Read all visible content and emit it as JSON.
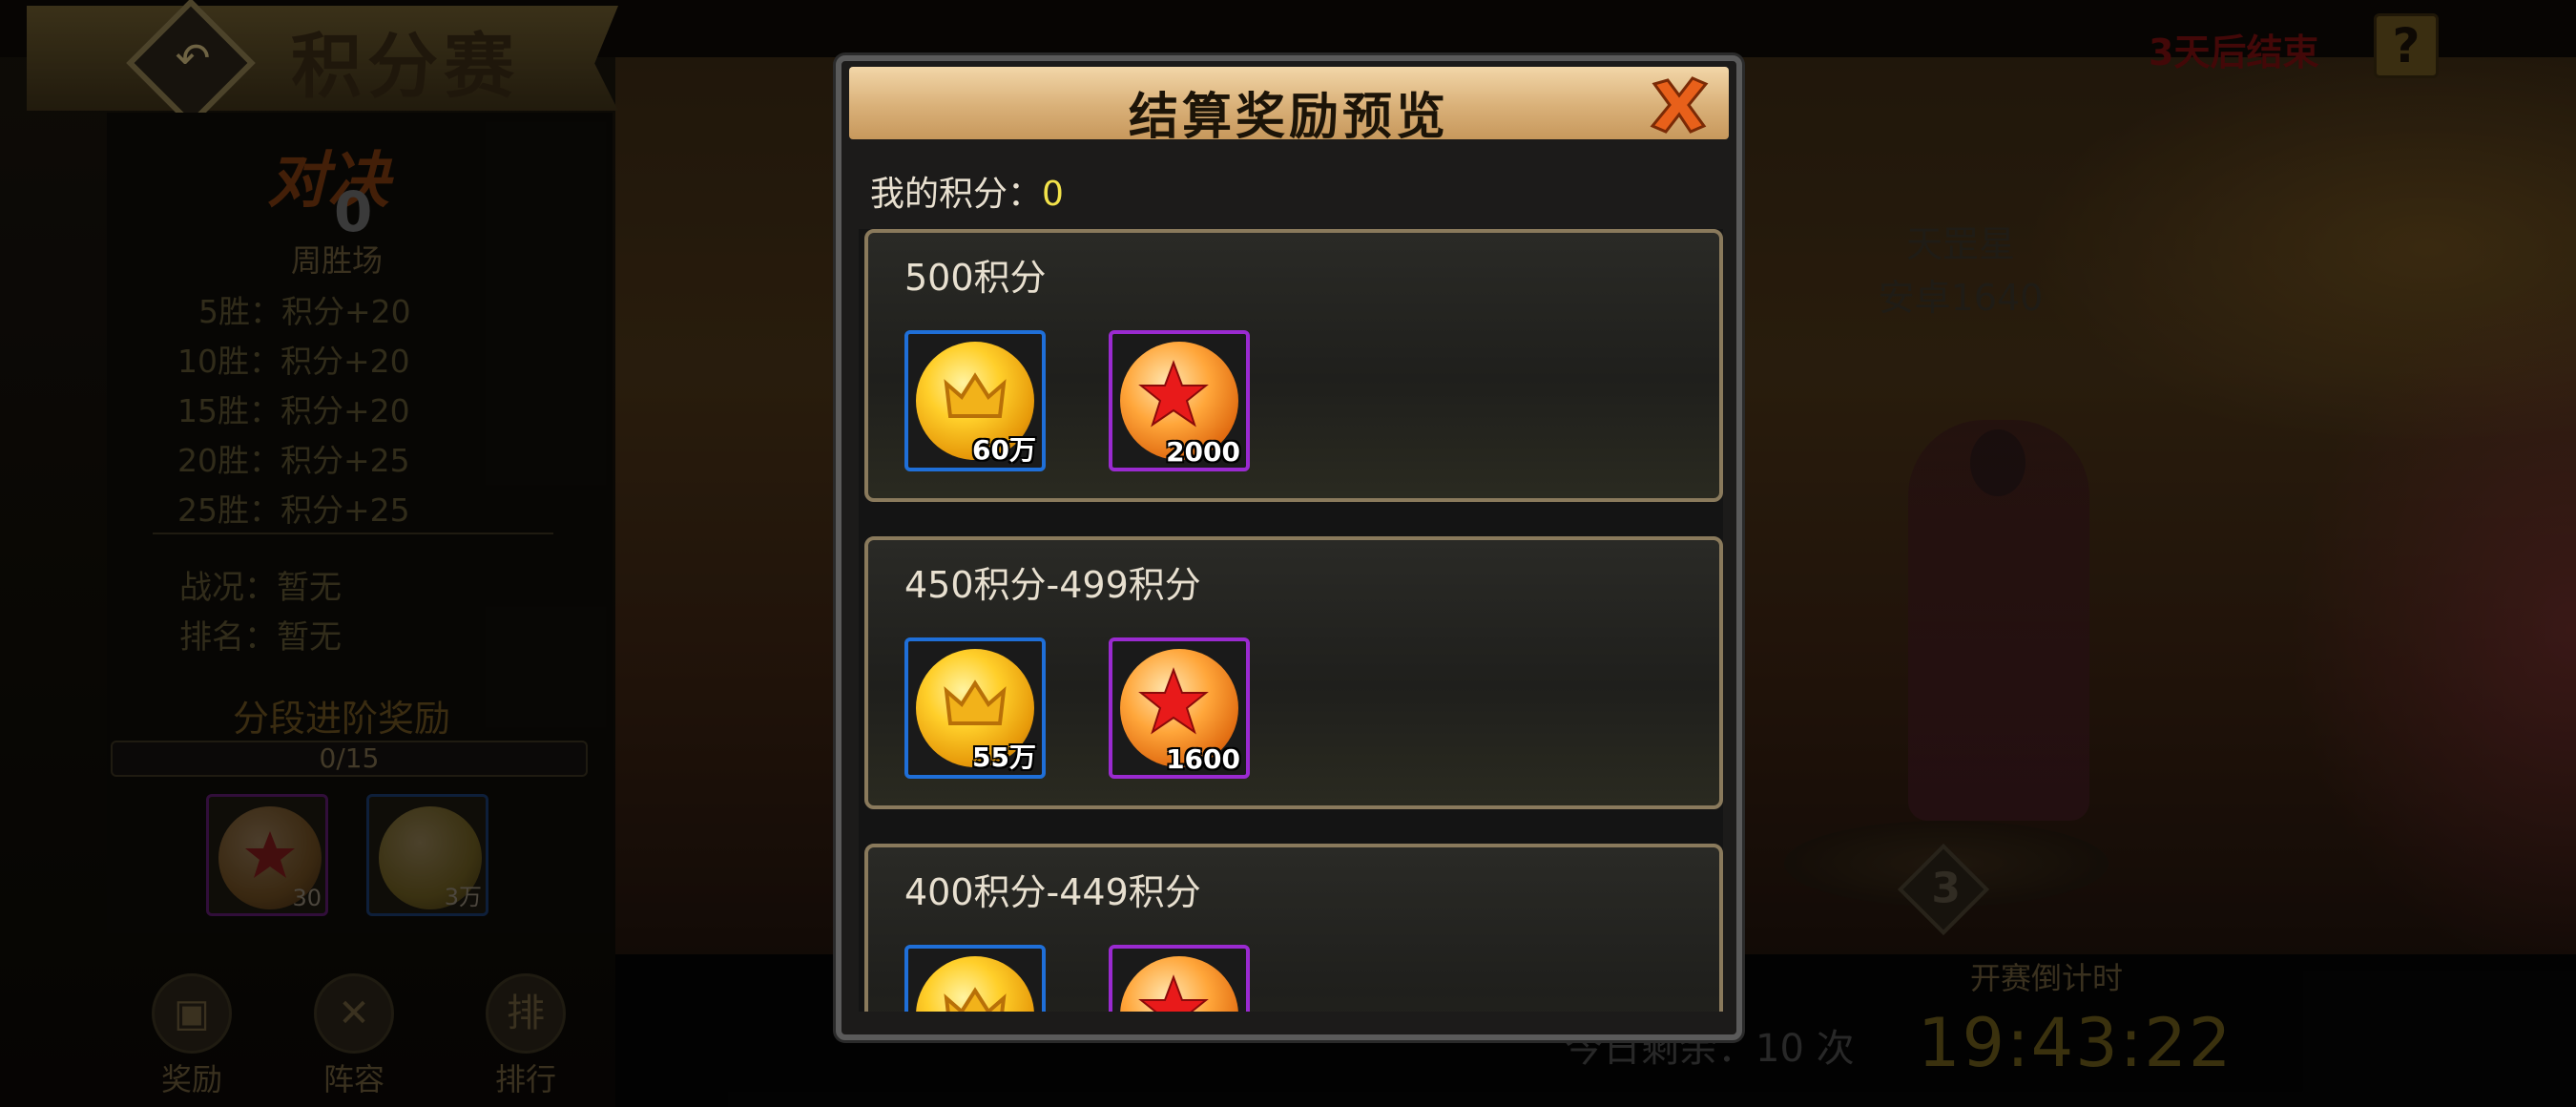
{
  "header": {
    "title": "积分赛",
    "back_icon": "back-arrow-icon",
    "ends_text": "3天后结束",
    "help_label": "?"
  },
  "left_panel": {
    "logo_text": "对决",
    "logo_count": "0",
    "arena_name": "周胜场",
    "rules": [
      {
        "wins": "5胜",
        "reward": "积分+20"
      },
      {
        "wins": "10胜",
        "reward": "积分+20"
      },
      {
        "wins": "15胜",
        "reward": "积分+20"
      },
      {
        "wins": "20胜",
        "reward": "积分+25"
      },
      {
        "wins": "25胜",
        "reward": "积分+25"
      }
    ],
    "record_label": "战况：",
    "record_value": "暂无",
    "rank_label": "排名：",
    "rank_value": "暂无",
    "stage_reward_title": "分段进阶奖励",
    "stage_progress": "0/15",
    "stage_items": [
      {
        "icon": "star-orb-icon",
        "count": "30",
        "frame": "purple"
      },
      {
        "icon": "gold-coin-icon",
        "count": "3万",
        "frame": "blue"
      }
    ]
  },
  "bottom_nav": [
    {
      "label": "奖励",
      "icon": "gift-icon"
    },
    {
      "label": "阵容",
      "icon": "crossed-swords-icon"
    },
    {
      "label": "排行",
      "icon": "ranking-icon"
    }
  ],
  "right_panel": {
    "server_star": "天罡星",
    "server_name": "安卓1640",
    "rank_badge": "3",
    "countdown_label": "开赛倒计时",
    "countdown_value": "19:43:22",
    "remaining_text": "今日剩余：10 次"
  },
  "modal": {
    "title": "结算奖励预览",
    "my_score_label": "我的积分：",
    "my_score_value": "0",
    "tiers": [
      {
        "range": "500积分",
        "rewards": [
          {
            "icon": "gold-coin-icon",
            "count": "60万",
            "frame": "blue"
          },
          {
            "icon": "star-orb-icon",
            "count": "2000",
            "frame": "purple"
          }
        ]
      },
      {
        "range": "450积分-499积分",
        "rewards": [
          {
            "icon": "gold-coin-icon",
            "count": "55万",
            "frame": "blue"
          },
          {
            "icon": "star-orb-icon",
            "count": "1600",
            "frame": "purple"
          }
        ]
      },
      {
        "range": "400积分-449积分",
        "rewards": [
          {
            "icon": "gold-coin-icon",
            "count": "",
            "frame": "blue"
          },
          {
            "icon": "star-orb-icon",
            "count": "",
            "frame": "purple"
          }
        ]
      }
    ]
  },
  "colors": {
    "modal_header": "#d9b078",
    "score_value": "#f2e24a",
    "frame_blue": "#1f6fd8",
    "frame_purple": "#9a2ad0",
    "ends_text": "#7a1010"
  }
}
